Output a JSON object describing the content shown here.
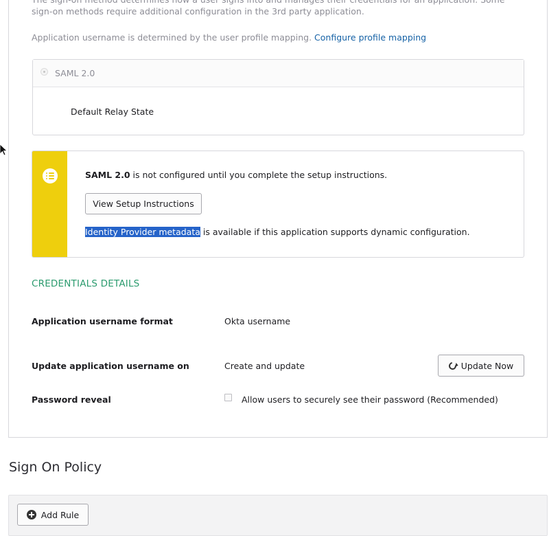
{
  "signon": {
    "intro_text": "The sign-on method determines how a user signs into and manages their credentials for an application. Some sign-on methods require additional configuration in the 3rd party application.",
    "mapping_text": "Application username is determined by the user profile mapping.",
    "mapping_link": "Configure profile mapping",
    "method_label": "SAML 2.0",
    "relay_state_label": "Default Relay State"
  },
  "notice": {
    "method_name": "SAML 2.0",
    "not_configured_text": " is not configured until you complete the setup instructions.",
    "setup_button": "View Setup Instructions",
    "metadata_link": "Identity Provider metadata",
    "metadata_text": " is available if this application supports dynamic configuration.",
    "icon": "list-icon",
    "accent_color": "#eecf0d"
  },
  "credentials": {
    "section_title": "CREDENTIALS DETAILS",
    "username_format_label": "Application username format",
    "username_format_value": "Okta username",
    "update_on_label": "Update application username on",
    "update_on_value": "Create and update",
    "update_button": "Update Now",
    "password_reveal_label": "Password reveal",
    "password_reveal_checkbox_label": "Allow users to securely see their password (Recommended)",
    "password_reveal_checked": false
  },
  "policy": {
    "title": "Sign On Policy",
    "add_rule_button": "Add Rule"
  },
  "colors": {
    "link": "#1662a6",
    "section_title": "#2b9b6e",
    "selection": "#2563c9"
  }
}
